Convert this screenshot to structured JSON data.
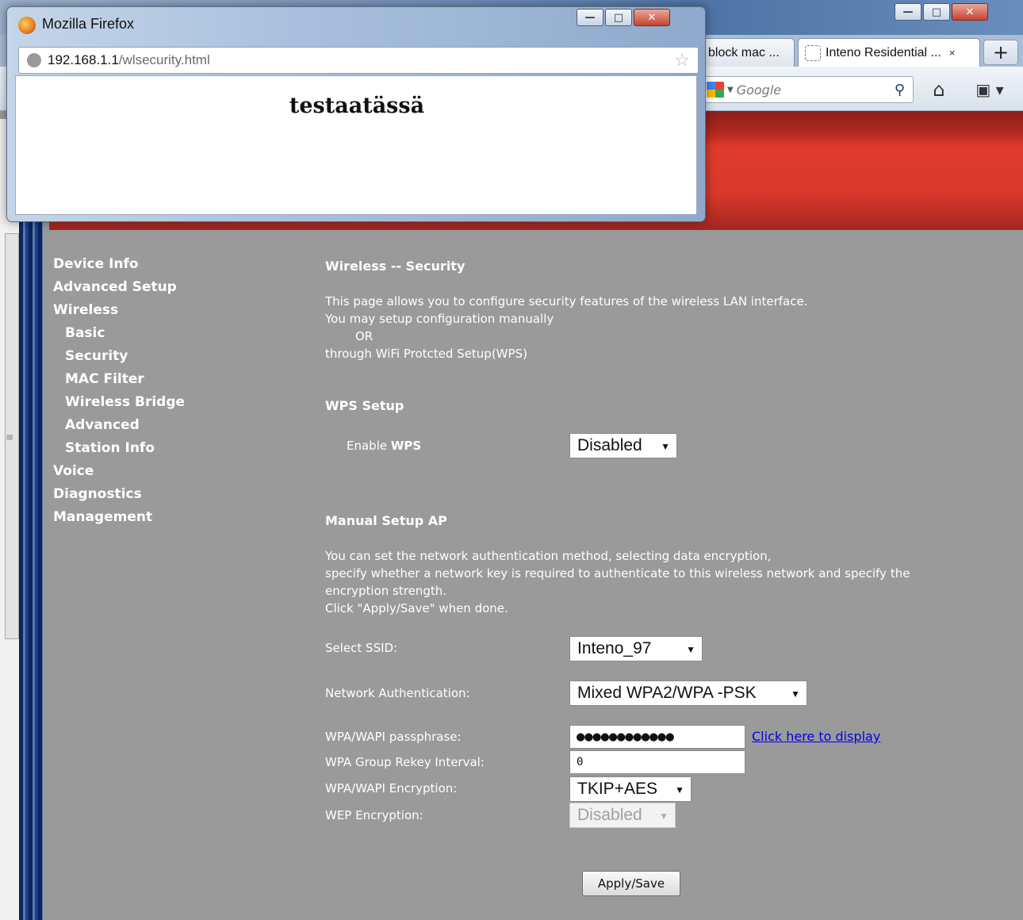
{
  "popup": {
    "title": "Mozilla Firefox",
    "url_host": "192.168.1.1",
    "url_path": "/wlsecurity.html",
    "heading": "testaatässä"
  },
  "browser": {
    "tabs": [
      {
        "label": "block mac ..."
      },
      {
        "label": "Inteno Residential ...",
        "close": "×"
      }
    ],
    "new_tab": "+",
    "search_placeholder": "Google"
  },
  "sidebar": {
    "items": [
      {
        "label": "Device Info",
        "level": 0
      },
      {
        "label": "Advanced Setup",
        "level": 0
      },
      {
        "label": "Wireless",
        "level": 0
      },
      {
        "label": "Basic",
        "level": 1
      },
      {
        "label": "Security",
        "level": 1
      },
      {
        "label": "MAC Filter",
        "level": 1
      },
      {
        "label": "Wireless Bridge",
        "level": 1
      },
      {
        "label": "Advanced",
        "level": 1
      },
      {
        "label": "Station Info",
        "level": 1
      },
      {
        "label": "Voice",
        "level": 0
      },
      {
        "label": "Diagnostics",
        "level": 0
      },
      {
        "label": "Management",
        "level": 0
      }
    ]
  },
  "content": {
    "title": "Wireless -- Security",
    "intro": [
      "This page allows you to configure security features of the wireless LAN interface.",
      "You may setup configuration manually",
      "OR",
      "through WiFi Protcted Setup(WPS)"
    ],
    "wps": {
      "heading": "WPS Setup",
      "enable_label_prefix": "Enable",
      "enable_label_bold": "WPS",
      "enable_value": "Disabled"
    },
    "manual": {
      "heading": "Manual Setup AP",
      "desc": [
        "You can set the network authentication method, selecting data encryption,",
        "specify whether a network key is required to authenticate to this wireless network and specify the",
        "encryption strength.",
        "Click \"Apply/Save\" when done."
      ],
      "ssid_label": "Select SSID:",
      "ssid_value": "Inteno_97",
      "auth_label": "Network Authentication:",
      "auth_value": "Mixed WPA2/WPA -PSK",
      "pass_label": "WPA/WAPI passphrase:",
      "pass_value": "●●●●●●●●●●●●",
      "pass_link": "Click here to display",
      "rekey_label": "WPA Group Rekey Interval:",
      "rekey_value": "0",
      "enc_label": "WPA/WAPI Encryption:",
      "enc_value": "TKIP+AES",
      "wep_label": "WEP Encryption:",
      "wep_value": "Disabled"
    },
    "apply_label": "Apply/Save"
  },
  "colors": {
    "page_bg": "#9a9a9a",
    "header_red": "#e03a2c",
    "link": "#0000ee"
  }
}
